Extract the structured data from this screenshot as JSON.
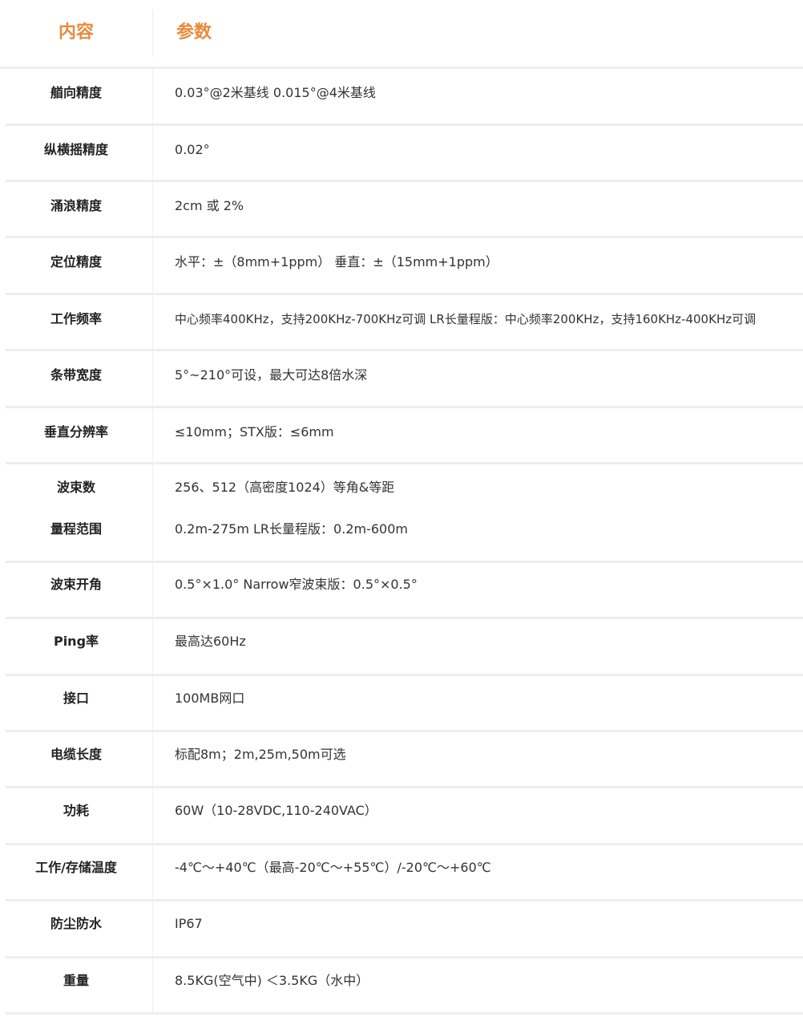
{
  "header": {
    "label_col": "内容",
    "value_col": "参数"
  },
  "rows": [
    {
      "label": "艏向精度",
      "value": "0.03°@2米基线   0.015°@4米基线"
    },
    {
      "label": "纵横摇精度",
      "value": "0.02°"
    },
    {
      "label": "涌浪精度",
      "value": "2cm 或 2%"
    },
    {
      "label": "定位精度",
      "value": "水平：±（8mm+1ppm）  垂直：±（15mm+1ppm）"
    },
    {
      "label": "工作频率",
      "value": "中心频率400KHz，支持200KHz-700KHz可调   LR长量程版：中心频率200KHz，支持160KHz-400KHz可调"
    },
    {
      "label": "条带宽度",
      "value": "5°~210°可设，最大可达8倍水深"
    },
    {
      "label": "垂直分辨率",
      "value": "≤10mm；STX版：≤6mm"
    },
    {
      "label": "波束数",
      "value": "256、512（高密度1024）等角&等距",
      "label2": "量程范围",
      "value2": "0.2m-275m   LR长量程版：0.2m-600m"
    },
    {
      "label": "波束开角",
      "value": "0.5°×1.0°   Narrow窄波束版：0.5°×0.5°"
    },
    {
      "label": "Ping率",
      "value": "最高达60Hz"
    },
    {
      "label": "接口",
      "value": "100MB网口"
    },
    {
      "label": "电缆长度",
      "value": "标配8m；2m,25m,50m可选"
    },
    {
      "label": "功耗",
      "value": "60W（10-28VDC,110-240VAC）"
    },
    {
      "label": "工作/存储温度",
      "value": "-4℃～+40℃（最高-20℃～+55℃）/-20℃～+60℃"
    },
    {
      "label": "防尘防水",
      "value": "IP67"
    },
    {
      "label": "重量",
      "value": "8.5KG(空气中)  ＜3.5KG（水中）"
    }
  ]
}
